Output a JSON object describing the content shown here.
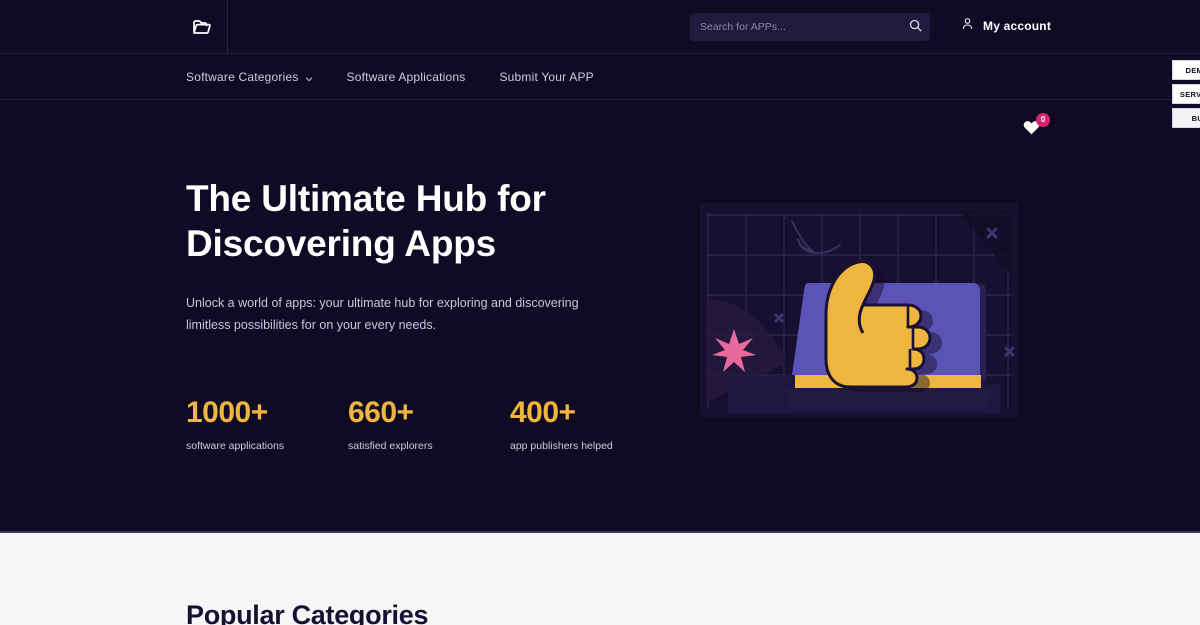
{
  "theme": {
    "dark_bg": "#110a25",
    "light_bg": "#f6f6f9",
    "accent_yellow": "#eeb63f",
    "accent_pink": "#d6256e",
    "illustration_purple": "#5b53b5",
    "star_pink": "#e8699b"
  },
  "topbar": {
    "logo_icon": "open-folder-icon",
    "search": {
      "placeholder": "Search for APPs...",
      "value": "",
      "icon": "search-icon"
    },
    "account": {
      "icon": "user-icon",
      "label": "My account"
    }
  },
  "nav": {
    "items": [
      {
        "label": "Software Categories",
        "has_dropdown": true,
        "icon": "chevron-down-icon"
      },
      {
        "label": "Software Applications",
        "has_dropdown": false
      },
      {
        "label": "Submit Your APP",
        "has_dropdown": false
      }
    ],
    "favorites": {
      "icon": "heart-icon",
      "count": "0"
    }
  },
  "demo_panel": {
    "buttons": [
      {
        "label": "DEMOS"
      },
      {
        "label": "SERVICES"
      },
      {
        "label": "BUY"
      }
    ]
  },
  "hero": {
    "title": "The Ultimate Hub for Discovering Apps",
    "subtitle": "Unlock a world of apps: your ultimate hub for exploring and discovering limitless possibilities for on your every needs.",
    "stats": [
      {
        "value": "1000+",
        "label": "software applications"
      },
      {
        "value": "660+",
        "label": "satisfied explorers"
      },
      {
        "value": "400+",
        "label": "app publishers helped"
      }
    ],
    "illustration": "thumbs-up-laptop-illustration"
  },
  "popular": {
    "title": "Popular Categories"
  }
}
